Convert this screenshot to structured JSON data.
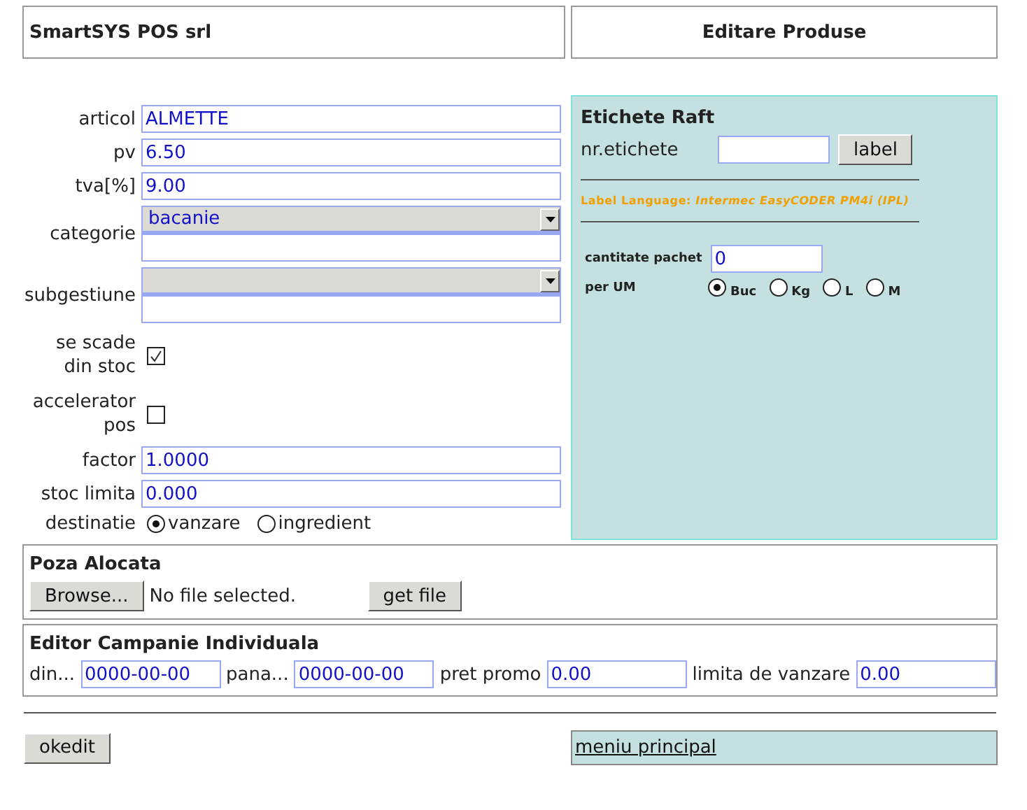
{
  "header": {
    "company": "SmartSYS POS srl",
    "title": "Editare Produse"
  },
  "fields": [
    {
      "kind": "text",
      "label": "articol",
      "value": "ALMETTE"
    },
    {
      "kind": "text",
      "label": "pv",
      "value": "6.50"
    },
    {
      "kind": "text",
      "label": "tva[%]",
      "value": "9.00"
    },
    {
      "kind": "select",
      "label": "categorie",
      "value": "bacanie"
    },
    {
      "kind": "select",
      "label": "subgestiune"
    },
    {
      "kind": "checkbox",
      "label": "se scade din stoc",
      "checked": true
    },
    {
      "kind": "checkbox",
      "label": "accelerator pos",
      "checked": false
    },
    {
      "kind": "text",
      "label": "factor",
      "value": "1.0000"
    },
    {
      "kind": "text",
      "label": "stoc limita",
      "value": "0.000"
    },
    {
      "kind": "radio",
      "label": "destinatie",
      "options": [
        {
          "label": "vanzare",
          "selected": true
        },
        {
          "label": "ingredient",
          "selected": false
        }
      ]
    }
  ],
  "labels_panel": {
    "title": "Etichete Raft",
    "count_label": "nr.etichete",
    "button": "label",
    "language": "Label Language: *Intermec EasyCODER PM4i (IPL)*",
    "pack_label": "cantitate pachet",
    "pack_value": "0",
    "unit_label": "per UM",
    "units": [
      {
        "label": "Buc",
        "selected": true
      },
      {
        "label": "Kg",
        "selected": false
      },
      {
        "label": "L",
        "selected": false
      },
      {
        "label": "M",
        "selected": false
      }
    ]
  },
  "picture_section": {
    "title": "Poza Alocata",
    "browse": "Browse...",
    "file_status": "No file selected.",
    "get_button": "get file"
  },
  "campaign": {
    "title": "Editor Campanie Individuala",
    "fields": [
      {
        "label": "din...",
        "value": "0000-00-00"
      },
      {
        "label": "pana...",
        "value": "0000-00-00"
      },
      {
        "label": "pret promo",
        "value": "0.00"
      },
      {
        "label": "limita de vanzare",
        "value": "0.00"
      }
    ]
  },
  "footer": {
    "ok_button": "okedit",
    "menu_link": "meniu principal"
  }
}
